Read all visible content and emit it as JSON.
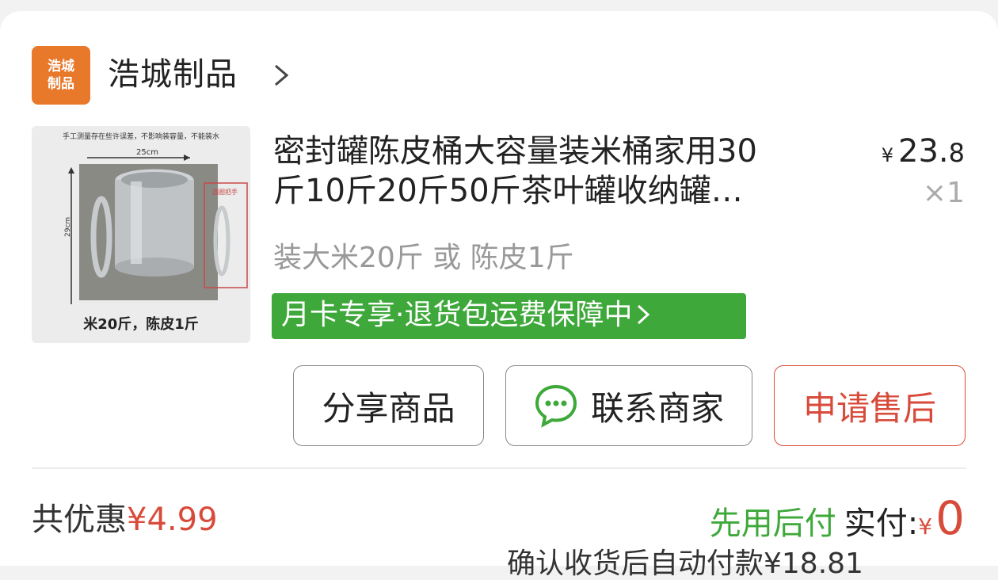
{
  "store": {
    "logo_text_1": "浩城",
    "logo_text_2": "制品",
    "name": "浩城制品"
  },
  "product": {
    "title_line1": "密封罐陈皮桶大容量装米桶家用30",
    "title_line2": "斤10斤20斤50斤茶叶罐收纳罐…",
    "price_symbol": "¥",
    "price_int": "23.",
    "price_dec": "8",
    "quantity": "×1",
    "variant": "装大米20斤 或 陈皮1斤",
    "image_caption": "米20斤，陈皮1斤",
    "image_note": "手工测量存在些许误差，不影响装容量，不能装水",
    "image_dim_width": "25cm",
    "image_dim_height": "29cm",
    "image_handle_label": "圆圈把手",
    "promo": "月卡专享·退货包运费保障中"
  },
  "actions": {
    "share": "分享商品",
    "contact": "联系商家",
    "after_sale": "申请售后"
  },
  "summary": {
    "discount_label": "共优惠",
    "discount_amount": "¥4.99",
    "pay_later": "先用后付",
    "paid_label": "实付:",
    "paid_symbol": "¥",
    "paid_amount": "0",
    "autopay_text": "确认收货后自动付款¥18.81"
  },
  "colors": {
    "accent_red": "#d84b3b",
    "accent_green": "#3ea83a",
    "logo_orange": "#e8782a"
  }
}
